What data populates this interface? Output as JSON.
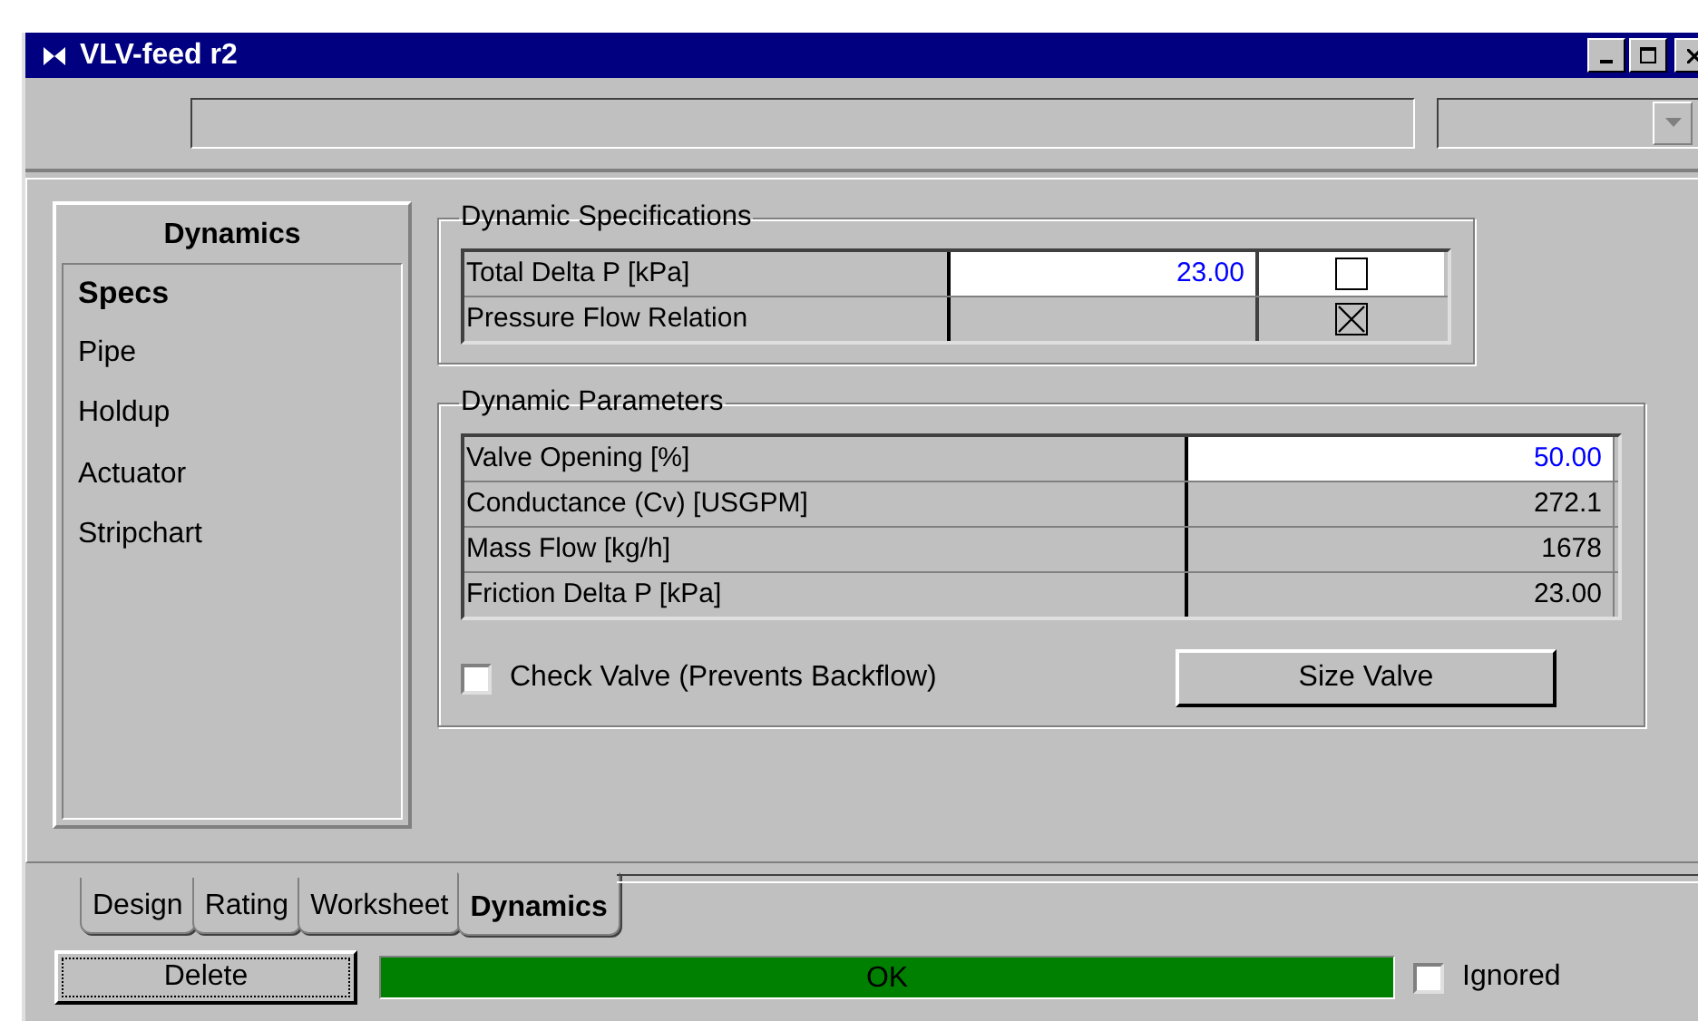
{
  "window": {
    "title": "VLV-feed r2"
  },
  "sidebar": {
    "title": "Dynamics",
    "items": [
      {
        "label": "Specs",
        "selected": true
      },
      {
        "label": "Pipe",
        "selected": false
      },
      {
        "label": "Holdup",
        "selected": false
      },
      {
        "label": "Actuator",
        "selected": false
      },
      {
        "label": "Stripchart",
        "selected": false
      }
    ]
  },
  "specifications": {
    "title": "Dynamic Specifications",
    "rows": [
      {
        "label": "Total Delta P [kPa]",
        "value": "23.00",
        "editable": true,
        "checked": false
      },
      {
        "label": "Pressure Flow Relation",
        "editable": false,
        "checked": true
      }
    ]
  },
  "parameters": {
    "title": "Dynamic Parameters",
    "rows": [
      {
        "label": "Valve Opening [%]",
        "value": "50.00",
        "editable": true
      },
      {
        "label": "Conductance (Cv) [USGPM]",
        "value": "272.1",
        "editable": false
      },
      {
        "label": "Mass Flow [kg/h]",
        "value": "1678",
        "editable": false
      },
      {
        "label": "Friction Delta P [kPa]",
        "value": "23.00",
        "editable": false
      }
    ],
    "check_valve": {
      "label": "Check Valve  (Prevents Backflow)",
      "checked": false
    },
    "size_button": "Size Valve"
  },
  "tabs": [
    {
      "label": "Design",
      "selected": false
    },
    {
      "label": "Rating",
      "selected": false
    },
    {
      "label": "Worksheet",
      "selected": false
    },
    {
      "label": "Dynamics",
      "selected": true
    }
  ],
  "footer": {
    "delete_button": "Delete",
    "status": "OK",
    "ignored": {
      "label": "Ignored",
      "checked": false
    }
  }
}
